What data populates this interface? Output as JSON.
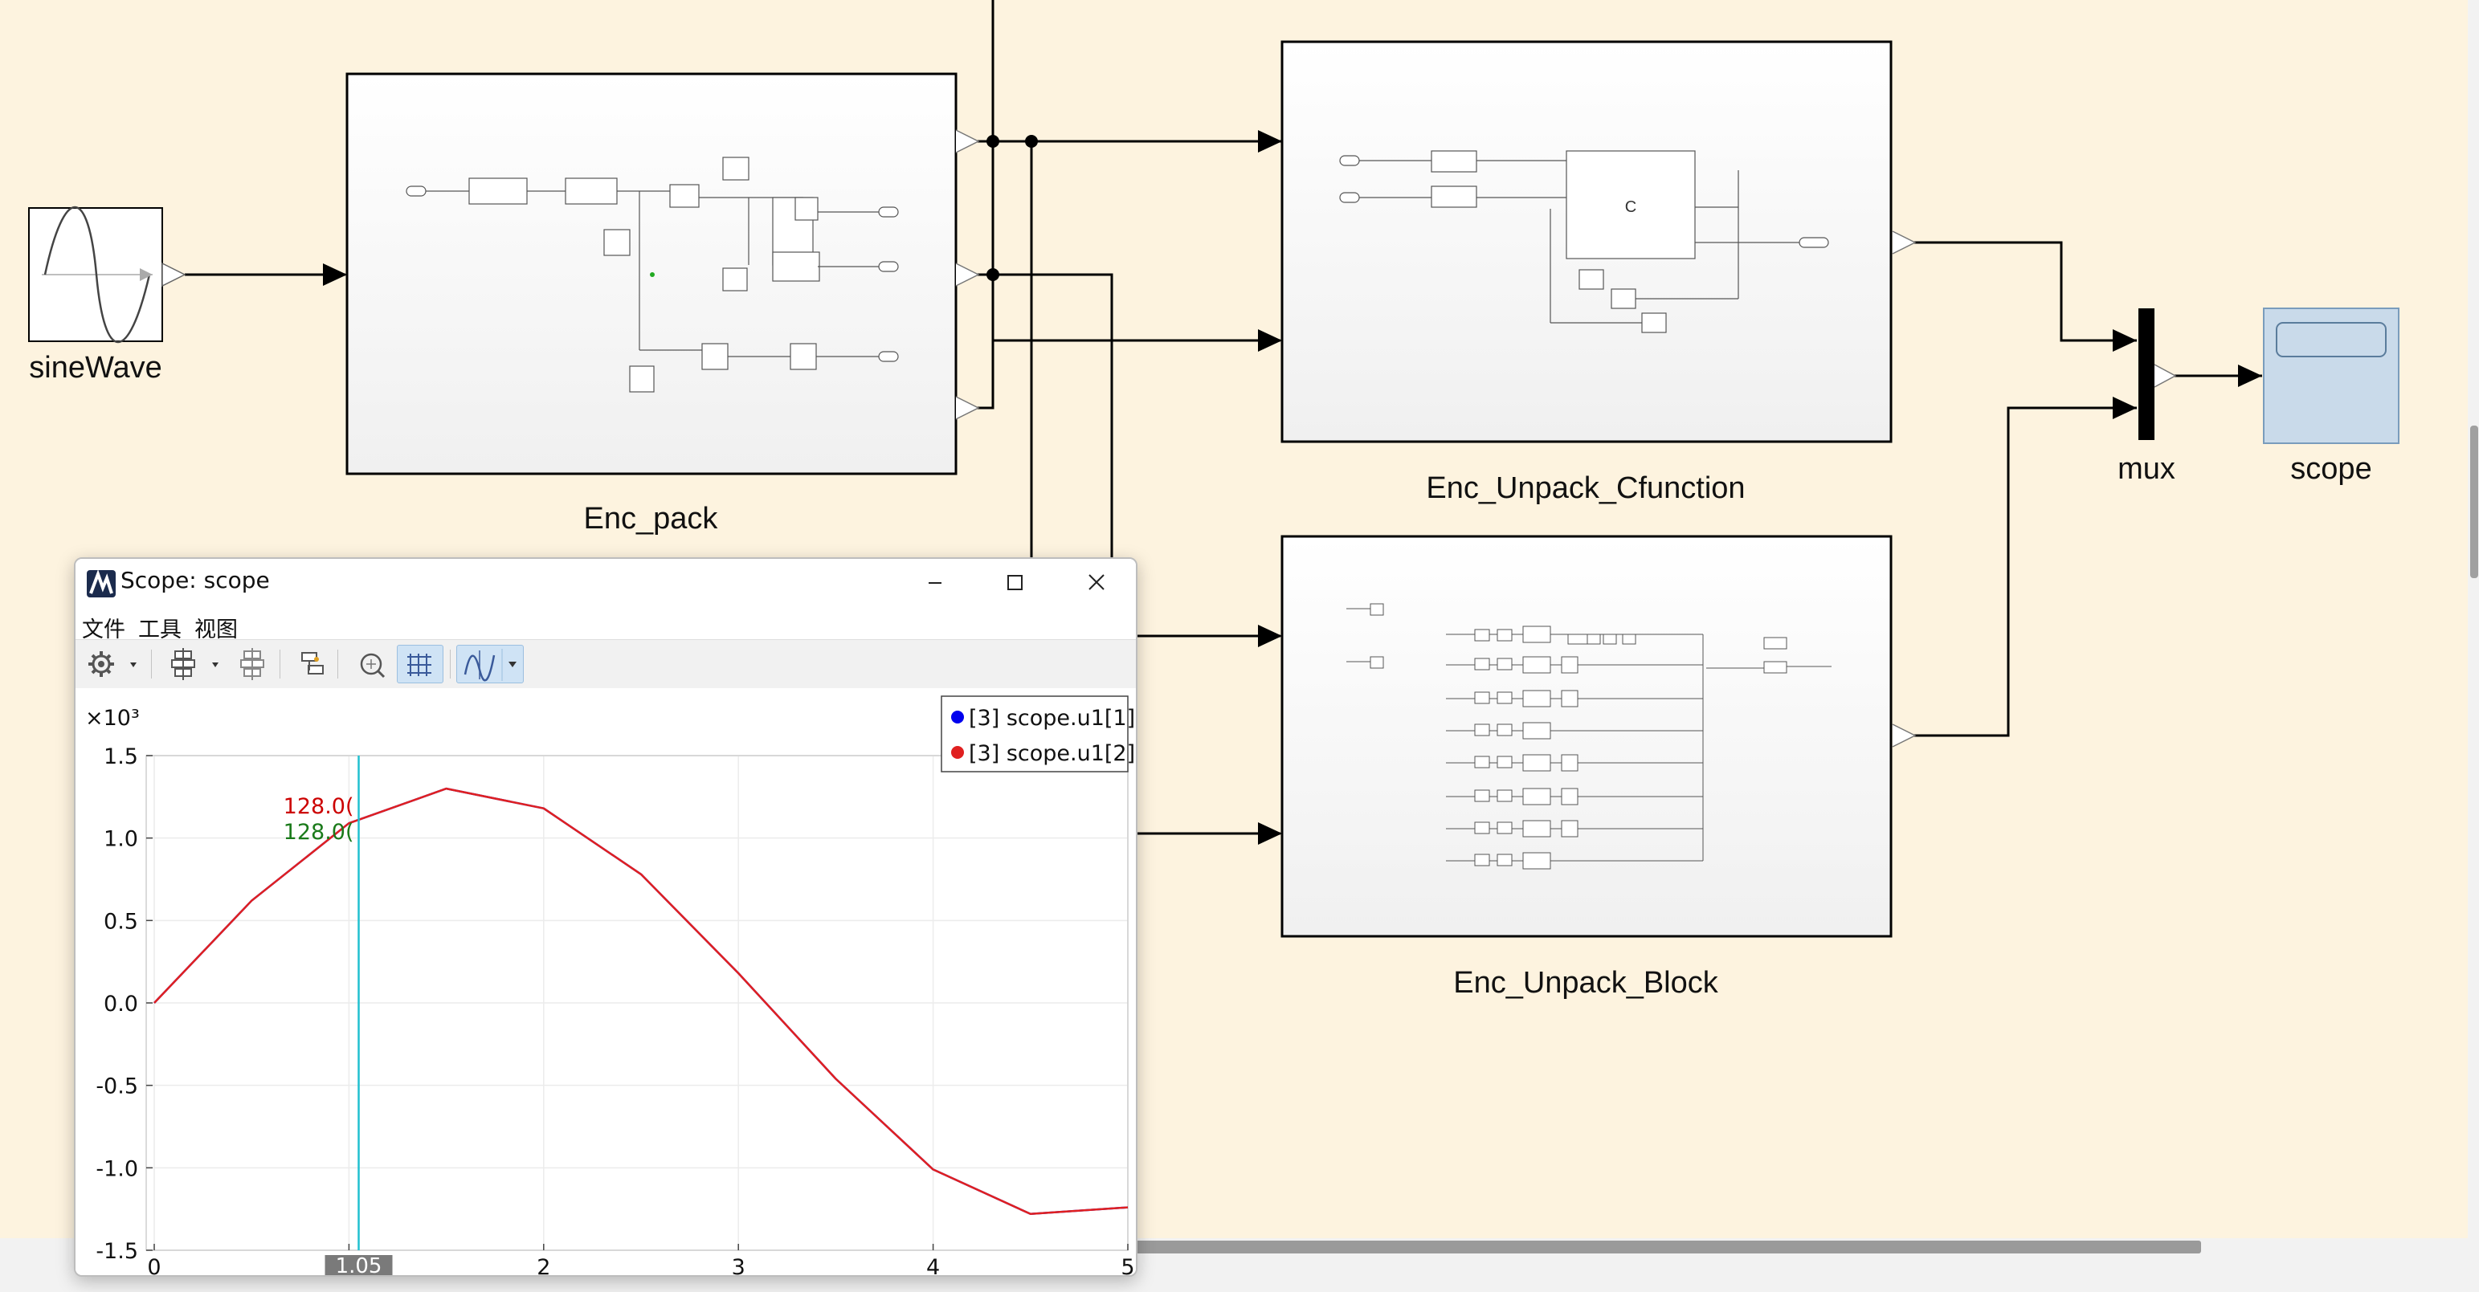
{
  "diagram": {
    "blocks": {
      "sine_wave": "sineWave",
      "enc_pack": "Enc_pack",
      "enc_unpack_cfunction": "Enc_Unpack_Cfunction",
      "enc_unpack_block": "Enc_Unpack_Block",
      "mux": "mux",
      "scope": "scope"
    },
    "cfunction_inner_label": "C",
    "colors": {
      "canvas": "#fdf3df",
      "scope_block": "#c9daea",
      "wire": "#000000"
    }
  },
  "scope_window": {
    "title": "Scope: scope",
    "menu": [
      "文件",
      "工具",
      "视图"
    ],
    "toolbar_icons": [
      "gear-icon",
      "dropdown-arrow-icon",
      "layout-icon",
      "dropdown-arrow-icon",
      "layout-disabled-icon",
      "export-icon",
      "zoom-fit-icon",
      "grid-icon",
      "cursor-measure-icon",
      "dropdown-arrow-icon"
    ],
    "window_controls": [
      "minimize-icon",
      "maximize-icon",
      "close-icon"
    ]
  },
  "chart_data": {
    "type": "line",
    "y_multiplier": "×10³",
    "xlim": [
      0,
      5
    ],
    "ylim": [
      -1.5,
      1.5
    ],
    "x_ticks": [
      "0",
      "1",
      "2",
      "3",
      "4",
      "5"
    ],
    "y_ticks": [
      "1.5",
      "1.0",
      "0.5",
      "0.0",
      "-0.5",
      "-1.0",
      "-1.5"
    ],
    "grid": true,
    "legend_position": "top-right",
    "series": [
      {
        "name": "[3] scope.u1[1]",
        "color": "#0000ee",
        "x": [
          0,
          0.5,
          1,
          1.5,
          2,
          2.5,
          3,
          3.5,
          4,
          4.5,
          5
        ],
        "y": [
          0,
          0.62,
          1.09,
          1.3,
          1.18,
          0.78,
          0.18,
          -0.46,
          -1.01,
          -1.28,
          -1.24
        ]
      },
      {
        "name": "[3] scope.u1[2]",
        "color": "#e02020",
        "x": [
          0,
          0.5,
          1,
          1.5,
          2,
          2.5,
          3,
          3.5,
          4,
          4.5,
          5
        ],
        "y": [
          0,
          0.62,
          1.09,
          1.3,
          1.18,
          0.78,
          0.18,
          -0.46,
          -1.01,
          -1.28,
          -1.24
        ]
      }
    ],
    "cursor": {
      "x": 1.05,
      "label": "1.05",
      "readouts": [
        {
          "text": "128.0(",
          "color": "#cc0000"
        },
        {
          "text": "128.0(",
          "color": "#1a7a1a"
        }
      ],
      "line_color": "#20c0d0"
    }
  }
}
